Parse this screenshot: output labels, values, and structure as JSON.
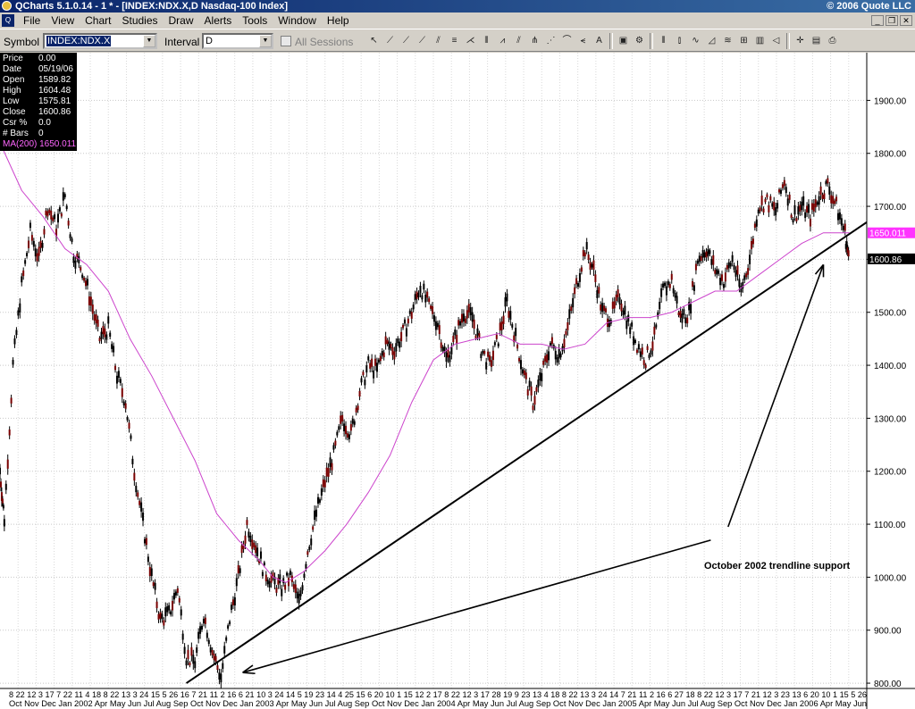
{
  "window": {
    "title": "QCharts 5.1.0.14 - 1 * - [INDEX:NDX.X,D Nasdaq-100 Index]",
    "copyright": "© 2006 Quote LLC"
  },
  "menu": [
    "File",
    "View",
    "Chart",
    "Studies",
    "Draw",
    "Alerts",
    "Tools",
    "Window",
    "Help"
  ],
  "toolbar": {
    "symbol_label": "Symbol",
    "symbol_value": "INDEX:NDX.X",
    "interval_label": "Interval",
    "interval_value": "D",
    "all_sessions_label": "All Sessions",
    "all_sessions_checked": false
  },
  "infobox": {
    "rows": [
      {
        "k": "Price",
        "v": "0.00"
      },
      {
        "k": "Date",
        "v": "05/19/06"
      },
      {
        "k": "Open",
        "v": "1589.82"
      },
      {
        "k": "High",
        "v": "1604.48"
      },
      {
        "k": "Low",
        "v": "1575.81"
      },
      {
        "k": "Close",
        "v": "1600.86"
      },
      {
        "k": "Csr %",
        "v": "0.0"
      },
      {
        "k": "# Bars",
        "v": "0"
      }
    ],
    "ma_label": "MA(200) 1650.011"
  },
  "chart_data": {
    "type": "line",
    "symbol": "INDEX:NDX.X",
    "interval": "D",
    "ylim": [
      790,
      1990
    ],
    "yticks": [
      800,
      900,
      1000,
      1100,
      1200,
      1300,
      1400,
      1500,
      1600,
      1700,
      1800,
      1900
    ],
    "ytick_labels": [
      "800.00",
      "900.00",
      "1000.00",
      "1100.00",
      "1200.00",
      "1300.00",
      "1400.00",
      "1500.00",
      "1600.00",
      "1700.00",
      "1800.00",
      "1900.00"
    ],
    "price_tag": "1600.86",
    "ma_tag": "1650.011",
    "xtick_day_labels": "8 22 12 3 17 7 22 11 4 18 8 22 13 3 24 15 5 26 16 7 21 11 2 16 6 21 10 3 24 14 5 19 23 14 4 25 15 6 20 10 1 15 12 2 17 8 22 12 3 17 28 19 9 23 13 4 18 8 22 13 3 24 14 7 21 11 2 16 6 27 18 8 22 12 3 17 7 21 12 3 23 13 6 20 10 1 15 5 26",
    "xtick_months": [
      "Oct",
      "Nov",
      "Dec",
      "Jan 2002",
      "Apr",
      "May",
      "Jun",
      "Jul",
      "Aug",
      "Sep",
      "Oct",
      "Nov",
      "Dec",
      "Jan 2003",
      "Apr",
      "May",
      "Jun",
      "Jul",
      "Aug",
      "Sep",
      "Oct",
      "Nov",
      "Dec",
      "Jan 2004",
      "Apr",
      "May",
      "Jun",
      "Jul",
      "Aug",
      "Sep",
      "Oct",
      "Nov",
      "Dec",
      "Jan 2005",
      "Apr",
      "May",
      "Jun",
      "Jul",
      "Aug",
      "Sep",
      "Oct",
      "Nov",
      "Dec",
      "Jan 2006",
      "Apr",
      "May",
      "Jun"
    ],
    "price_series": {
      "name": "INDEX:NDX.X",
      "color": "#7a0000",
      "points": [
        [
          0,
          1200
        ],
        [
          2,
          1110
        ],
        [
          6,
          1400
        ],
        [
          10,
          1550
        ],
        [
          14,
          1650
        ],
        [
          18,
          1600
        ],
        [
          22,
          1700
        ],
        [
          26,
          1660
        ],
        [
          30,
          1720
        ],
        [
          34,
          1610
        ],
        [
          38,
          1580
        ],
        [
          42,
          1520
        ],
        [
          46,
          1450
        ],
        [
          50,
          1470
        ],
        [
          54,
          1380
        ],
        [
          58,
          1330
        ],
        [
          62,
          1200
        ],
        [
          66,
          1100
        ],
        [
          70,
          1000
        ],
        [
          74,
          920
        ],
        [
          78,
          930
        ],
        [
          82,
          980
        ],
        [
          86,
          850
        ],
        [
          90,
          840
        ],
        [
          94,
          930
        ],
        [
          98,
          860
        ],
        [
          102,
          810
        ],
        [
          106,
          920
        ],
        [
          110,
          1000
        ],
        [
          114,
          1100
        ],
        [
          118,
          1060
        ],
        [
          122,
          1010
        ],
        [
          126,
          990
        ],
        [
          130,
          980
        ],
        [
          134,
          1000
        ],
        [
          138,
          950
        ],
        [
          142,
          1050
        ],
        [
          146,
          1120
        ],
        [
          150,
          1180
        ],
        [
          154,
          1230
        ],
        [
          158,
          1300
        ],
        [
          162,
          1270
        ],
        [
          166,
          1350
        ],
        [
          170,
          1400
        ],
        [
          174,
          1390
        ],
        [
          178,
          1440
        ],
        [
          182,
          1430
        ],
        [
          186,
          1460
        ],
        [
          190,
          1500
        ],
        [
          194,
          1550
        ],
        [
          198,
          1510
        ],
        [
          202,
          1480
        ],
        [
          206,
          1410
        ],
        [
          210,
          1450
        ],
        [
          214,
          1500
        ],
        [
          218,
          1490
        ],
        [
          222,
          1430
        ],
        [
          226,
          1400
        ],
        [
          230,
          1450
        ],
        [
          234,
          1520
        ],
        [
          238,
          1450
        ],
        [
          242,
          1380
        ],
        [
          246,
          1330
        ],
        [
          250,
          1380
        ],
        [
          254,
          1440
        ],
        [
          258,
          1420
        ],
        [
          262,
          1470
        ],
        [
          266,
          1550
        ],
        [
          270,
          1620
        ],
        [
          274,
          1580
        ],
        [
          278,
          1500
        ],
        [
          282,
          1490
        ],
        [
          286,
          1530
        ],
        [
          290,
          1480
        ],
        [
          294,
          1440
        ],
        [
          298,
          1410
        ],
        [
          302,
          1450
        ],
        [
          306,
          1540
        ],
        [
          310,
          1560
        ],
        [
          314,
          1490
        ],
        [
          318,
          1500
        ],
        [
          322,
          1600
        ],
        [
          326,
          1620
        ],
        [
          330,
          1580
        ],
        [
          334,
          1560
        ],
        [
          338,
          1600
        ],
        [
          342,
          1540
        ],
        [
          346,
          1600
        ],
        [
          350,
          1700
        ],
        [
          354,
          1710
        ],
        [
          358,
          1690
        ],
        [
          362,
          1750
        ],
        [
          366,
          1680
        ],
        [
          370,
          1700
        ],
        [
          374,
          1680
        ],
        [
          378,
          1720
        ],
        [
          382,
          1740
        ],
        [
          386,
          1700
        ],
        [
          390,
          1650
        ],
        [
          392,
          1590
        ]
      ]
    },
    "ma_series": {
      "name": "MA(200)",
      "color": "#cc44cc",
      "points": [
        [
          0,
          1820
        ],
        [
          10,
          1730
        ],
        [
          20,
          1680
        ],
        [
          30,
          1620
        ],
        [
          40,
          1590
        ],
        [
          50,
          1540
        ],
        [
          60,
          1450
        ],
        [
          70,
          1380
        ],
        [
          80,
          1300
        ],
        [
          90,
          1220
        ],
        [
          100,
          1120
        ],
        [
          110,
          1070
        ],
        [
          120,
          1030
        ],
        [
          126,
          1000
        ],
        [
          132,
          990
        ],
        [
          140,
          1010
        ],
        [
          150,
          1050
        ],
        [
          160,
          1100
        ],
        [
          170,
          1160
        ],
        [
          180,
          1230
        ],
        [
          190,
          1330
        ],
        [
          200,
          1410
        ],
        [
          210,
          1440
        ],
        [
          220,
          1450
        ],
        [
          230,
          1460
        ],
        [
          240,
          1440
        ],
        [
          250,
          1440
        ],
        [
          260,
          1430
        ],
        [
          270,
          1440
        ],
        [
          280,
          1480
        ],
        [
          290,
          1490
        ],
        [
          300,
          1490
        ],
        [
          310,
          1500
        ],
        [
          320,
          1520
        ],
        [
          330,
          1540
        ],
        [
          340,
          1540
        ],
        [
          350,
          1570
        ],
        [
          360,
          1600
        ],
        [
          370,
          1630
        ],
        [
          380,
          1650
        ],
        [
          392,
          1650
        ]
      ]
    },
    "trendline": {
      "from": [
        86,
        800
      ],
      "to": [
        400,
        1670
      ]
    },
    "annotation": "October 2002 trendline support",
    "arrows": [
      {
        "from": [
          328,
          1070
        ],
        "to": [
          112,
          820
        ]
      },
      {
        "from": [
          336,
          1095
        ],
        "to": [
          380,
          1590
        ]
      }
    ]
  }
}
